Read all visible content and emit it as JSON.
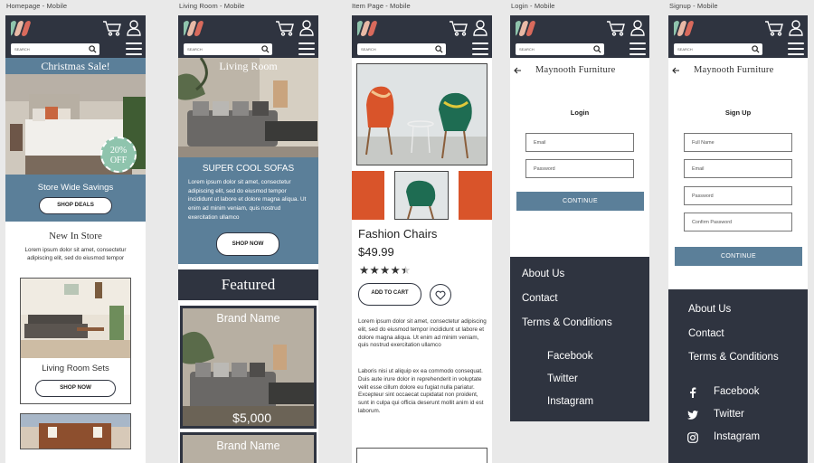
{
  "frames": {
    "home": "Homepage - Mobile",
    "living": "Living Room - Mobile",
    "item": "Item Page - Mobile",
    "login": "Login - Mobile",
    "signup": "Signup - Mobile"
  },
  "search_placeholder": "SEARCH",
  "colors": {
    "navy": "#2f3440",
    "slate": "#5b7f99",
    "badge": "#8fc4ad"
  },
  "home": {
    "banner": "Christmas Sale!",
    "badge_pct": "20%",
    "badge_off": "OFF",
    "savings": "Store Wide Savings",
    "shop_deals": "SHOP DEALS",
    "new_in": "New In Store",
    "new_desc": "Lorem ipsum dolor sit amet, consectetur adipiscing elit, sed do eiusmod tempor",
    "card_title": "Living Room Sets",
    "shop_now": "SHOP NOW"
  },
  "living": {
    "title": "Living Room",
    "heading": "SUPER COOL SOFAS",
    "desc": "Lorem ipsum dolor sit amet, consectetur adipiscing elit, sed do eiusmod tempor incididunt ut labore et dolore magna aliqua. Ut enim ad minim veniam, quis nostrud exercitation ullamco",
    "shop_now": "SHOP NOW",
    "featured": "Featured",
    "brand1": "Brand Name",
    "price1": "$5,000",
    "brand2": "Brand Name"
  },
  "item": {
    "name": "Fashion Chairs",
    "price": "$49.99",
    "stars": "★★★★",
    "rating": 4.5,
    "add_to_cart": "ADD TO CART",
    "desc1": "Lorem ipsum dolor sit amet, consectetur adipiscing elit, sed do eiusmod tempor incididunt ut labore et dolore magna aliqua. Ut enim ad minim veniam, quis nostrud exercitation ullamco",
    "desc2": "Laboris nisi ut aliquip ex ea commodo consequat. Duis aute irure dolor in reprehenderit in voluptate velit esse cillum dolore eu fugiat nulla pariatur. Excepteur sint occaecat cupidatat non proident, sunt in culpa qui officia deserunt mollit anim id est laborum."
  },
  "store_name": "Maynooth Furniture",
  "login": {
    "title": "Login",
    "email": "Email",
    "password": "Password",
    "continue": "CONTINUE"
  },
  "signup": {
    "title": "Sign Up",
    "full_name": "Full Name",
    "email": "Email",
    "password": "Password",
    "confirm": "Confirm Password",
    "continue": "CONTINUE"
  },
  "footer": {
    "about": "About Us",
    "contact": "Contact",
    "terms": "Terms & Conditions",
    "facebook": "Facebook",
    "twitter": "Twitter",
    "instagram": "Instagram"
  }
}
